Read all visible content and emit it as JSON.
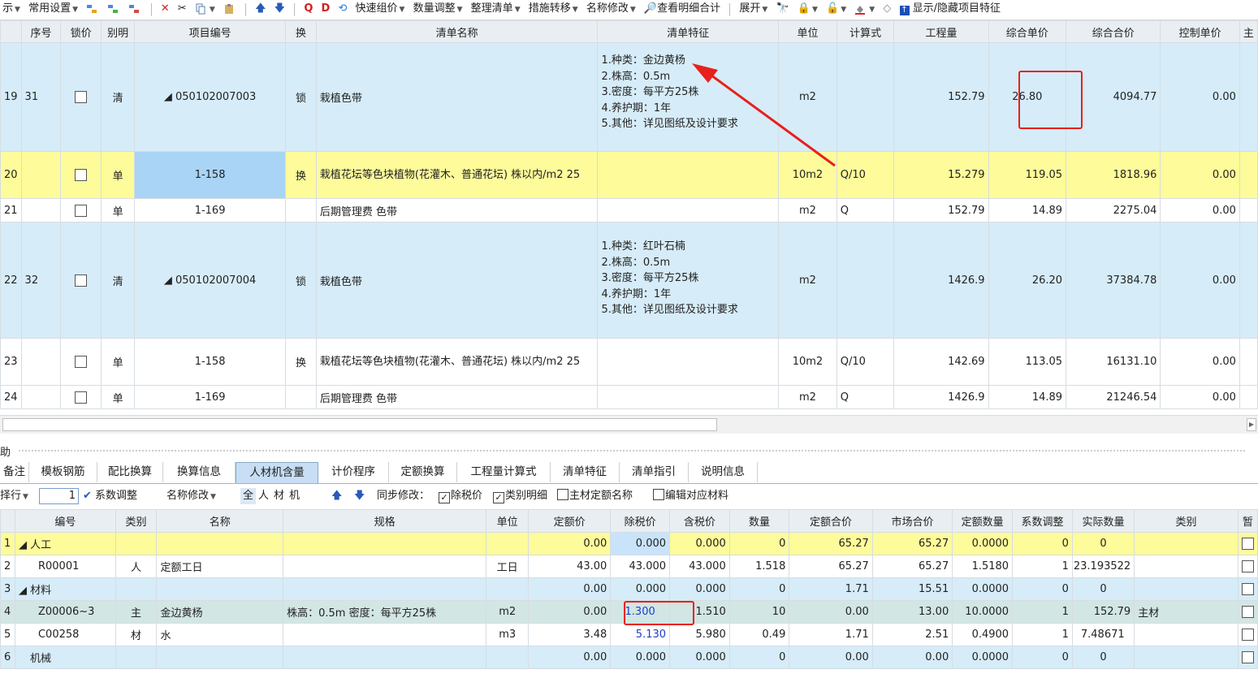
{
  "toolbar": {
    "items": [
      "示",
      "常用设置",
      "快速组价",
      "数量调整",
      "整理清单",
      "措施转移",
      "名称修改",
      "查看明细合计",
      "展开",
      "显示/隐藏项目特征"
    ]
  },
  "upper": {
    "headers": [
      "",
      "序号",
      "锁价",
      "别明",
      "项目编号",
      "换",
      "清单名称",
      "清单特征",
      "单位",
      "计算式",
      "工程量",
      "综合单价",
      "综合合价",
      "控制单价",
      "主"
    ],
    "rows": [
      {
        "rn": "19",
        "seq": "31",
        "type": "清",
        "code": "◢ 050102007003",
        "swap": "锁",
        "name": "栽植色带",
        "feature": "1.种类：金边黄杨\n2.株高：0.5m\n3.密度：每平方25株\n4.养护期：1年\n5.其他：详见图纸及设计要求",
        "unit": "m2",
        "formula": "",
        "qty": "152.79",
        "price": "26.80",
        "total": "4094.77",
        "ctrl": "0.00"
      },
      {
        "rn": "20",
        "seq": "",
        "type": "单",
        "code": "1-158",
        "swap": "换",
        "name": "栽植花坛等色块植物(花灌木、普通花坛) 株以内/m2 25",
        "feature": "",
        "unit": "10m2",
        "formula": "Q/10",
        "qty": "15.279",
        "price": "119.05",
        "total": "1818.96",
        "ctrl": "0.00"
      },
      {
        "rn": "21",
        "seq": "",
        "type": "单",
        "code": "1-169",
        "swap": "",
        "name": "后期管理费 色带",
        "feature": "",
        "unit": "m2",
        "formula": "Q",
        "qty": "152.79",
        "price": "14.89",
        "total": "2275.04",
        "ctrl": "0.00"
      },
      {
        "rn": "22",
        "seq": "32",
        "type": "清",
        "code": "◢ 050102007004",
        "swap": "锁",
        "name": "栽植色带",
        "feature": "1.种类：红叶石楠\n2.株高：0.5m\n3.密度：每平方25株\n4.养护期：1年\n5.其他：详见图纸及设计要求",
        "unit": "m2",
        "formula": "",
        "qty": "1426.9",
        "price": "26.20",
        "total": "37384.78",
        "ctrl": "0.00"
      },
      {
        "rn": "23",
        "seq": "",
        "type": "单",
        "code": "1-158",
        "swap": "换",
        "name": "栽植花坛等色块植物(花灌木、普通花坛) 株以内/m2 25",
        "feature": "",
        "unit": "10m2",
        "formula": "Q/10",
        "qty": "142.69",
        "price": "113.05",
        "total": "16131.10",
        "ctrl": "0.00"
      },
      {
        "rn": "24",
        "seq": "",
        "type": "单",
        "code": "1-169",
        "swap": "",
        "name": "后期管理费 色带",
        "feature": "",
        "unit": "m2",
        "formula": "Q",
        "qty": "1426.9",
        "price": "14.89",
        "total": "21246.54",
        "ctrl": "0.00"
      }
    ]
  },
  "panel": {
    "title": "助"
  },
  "tabs": [
    "备注",
    "模板钢筋",
    "配比换算",
    "换算信息",
    "人材机含量",
    "计价程序",
    "定额换算",
    "工程量计算式",
    "清单特征",
    "清单指引",
    "说明信息"
  ],
  "subbar": {
    "row_label": "择行",
    "spin_value": "1",
    "coef_adjust": "系数调整",
    "rename": "名称修改",
    "filters": [
      "全",
      "人",
      "材",
      "机"
    ],
    "sync_label": "同步修改：",
    "checks": [
      {
        "label": "除税价",
        "checked": true
      },
      {
        "label": "类别明细",
        "checked": true
      },
      {
        "label": "主材定额名称",
        "checked": false
      },
      {
        "label": "编辑对应材料",
        "checked": false
      }
    ]
  },
  "lower": {
    "headers": [
      "",
      "编号",
      "类别",
      "名称",
      "规格",
      "单位",
      "定额价",
      "除税价",
      "含税价",
      "数量",
      "定额合价",
      "市场合价",
      "定额数量",
      "系数调整",
      "实际数量",
      "类别",
      "暂"
    ],
    "rows": [
      {
        "rn": "1",
        "code": "◢ 人工",
        "cat": "",
        "name": "",
        "spec": "",
        "unit": "",
        "quota": "0.00",
        "extax": "0.000",
        "intax": "0.000",
        "amt": "0",
        "qtotal": "65.27",
        "mtotal": "65.27",
        "qamt": "0.0000",
        "coef": "0",
        "real": "0",
        "kind": ""
      },
      {
        "rn": "2",
        "code": "R00001",
        "cat": "人",
        "name": "定额工日",
        "spec": "",
        "unit": "工日",
        "quota": "43.00",
        "extax": "43.000",
        "intax": "43.000",
        "amt": "1.518",
        "qtotal": "65.27",
        "mtotal": "65.27",
        "qamt": "1.5180",
        "coef": "1",
        "real": "23.193522",
        "kind": ""
      },
      {
        "rn": "3",
        "code": "◢ 材料",
        "cat": "",
        "name": "",
        "spec": "",
        "unit": "",
        "quota": "0.00",
        "extax": "0.000",
        "intax": "0.000",
        "amt": "0",
        "qtotal": "1.71",
        "mtotal": "15.51",
        "qamt": "0.0000",
        "coef": "0",
        "real": "0",
        "kind": ""
      },
      {
        "rn": "4",
        "code": "Z00006~3",
        "cat": "主",
        "name": "金边黄杨",
        "spec": "株高：0.5m  密度：每平方25株",
        "unit": "m2",
        "quota": "0.00",
        "extax": "1.300",
        "intax": "1.510",
        "amt": "10",
        "qtotal": "0.00",
        "mtotal": "13.00",
        "qamt": "10.0000",
        "coef": "1",
        "real": "152.79",
        "kind": "主材"
      },
      {
        "rn": "5",
        "code": "C00258",
        "cat": "材",
        "name": "水",
        "spec": "",
        "unit": "m3",
        "quota": "3.48",
        "extax": "5.130",
        "intax": "5.980",
        "amt": "0.49",
        "qtotal": "1.71",
        "mtotal": "2.51",
        "qamt": "0.4900",
        "coef": "1",
        "real": "7.48671",
        "kind": ""
      },
      {
        "rn": "6",
        "code": "机械",
        "cat": "",
        "name": "",
        "spec": "",
        "unit": "",
        "quota": "0.00",
        "extax": "0.000",
        "intax": "0.000",
        "amt": "0",
        "qtotal": "0.00",
        "mtotal": "0.00",
        "qamt": "0.0000",
        "coef": "0",
        "real": "0",
        "kind": ""
      }
    ]
  },
  "colors": {
    "highlight_red": "#e8201c",
    "selected_row": "#fdfb9a",
    "list_row": "#d6ecf8",
    "blue_value": "#1c3ecf"
  }
}
